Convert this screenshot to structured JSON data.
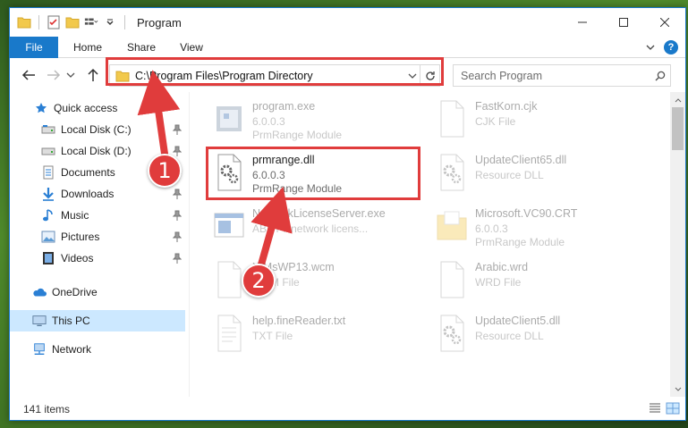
{
  "window": {
    "title": "Program"
  },
  "ribbon": {
    "tabs": [
      {
        "label": "File"
      },
      {
        "label": "Home"
      },
      {
        "label": "Share"
      },
      {
        "label": "View"
      }
    ],
    "help": "?"
  },
  "navbar": {
    "address": "C:\\Program Files\\Program Directory",
    "search_placeholder": "Search Program"
  },
  "nav_pane": {
    "items": [
      {
        "label": "Quick access",
        "icon": "star-icon"
      },
      {
        "label": "Local Disk (C:)",
        "icon": "drive-icon",
        "pinned": true
      },
      {
        "label": "Local Disk (D:)",
        "icon": "drive-icon",
        "pinned": true
      },
      {
        "label": "Documents",
        "icon": "documents-icon",
        "pinned": true
      },
      {
        "label": "Downloads",
        "icon": "download-icon",
        "pinned": true
      },
      {
        "label": "Music",
        "icon": "music-icon",
        "pinned": true
      },
      {
        "label": "Pictures",
        "icon": "pictures-icon",
        "pinned": true
      },
      {
        "label": "Videos",
        "icon": "videos-icon",
        "pinned": true
      },
      {
        "label": "OneDrive",
        "icon": "cloud-icon"
      },
      {
        "label": "This PC",
        "icon": "computer-icon",
        "selected": true
      },
      {
        "label": "Network",
        "icon": "network-icon"
      }
    ]
  },
  "files": [
    {
      "name": "program.exe",
      "line2": "6.0.0.3",
      "line3": "PrmRange Module",
      "icon": "exe-icon"
    },
    {
      "name": "FastKorn.cjk",
      "line2": "CJK File",
      "line3": "",
      "icon": "file-icon"
    },
    {
      "name": "prmrange.dll",
      "line2": "6.0.0.3",
      "line3": "PrmRange Module",
      "icon": "dll-gear-icon"
    },
    {
      "name": "UpdateClient65.dll",
      "line2": "Resource DLL",
      "line3": "",
      "icon": "dll-gear-icon"
    },
    {
      "name": "NetworkLicenseServer.exe",
      "line2": "ABBYY network licens...",
      "line3": "",
      "icon": "app-window-icon"
    },
    {
      "name": "Microsoft.VC90.CRT",
      "line2": "6.0.0.3",
      "line3": "PrmRange Module",
      "icon": "folder-icon"
    },
    {
      "name": "XfMsWP13.wcm",
      "line2": "WCM File",
      "line3": "",
      "icon": "file-icon"
    },
    {
      "name": "Arabic.wrd",
      "line2": "WRD File",
      "line3": "",
      "icon": "file-icon"
    },
    {
      "name": "help.fineReader.txt",
      "line2": "TXT File",
      "line3": "",
      "icon": "text-file-icon"
    },
    {
      "name": "UpdateClient5.dll",
      "line2": "Resource DLL",
      "line3": "",
      "icon": "dll-gear-icon"
    }
  ],
  "status": {
    "items_count": "141 items"
  },
  "annotations": {
    "step1": "1",
    "step2": "2",
    "color": "#e03c3c"
  },
  "colors": {
    "accent": "#1979ca",
    "selected_bg": "#cce8ff"
  }
}
